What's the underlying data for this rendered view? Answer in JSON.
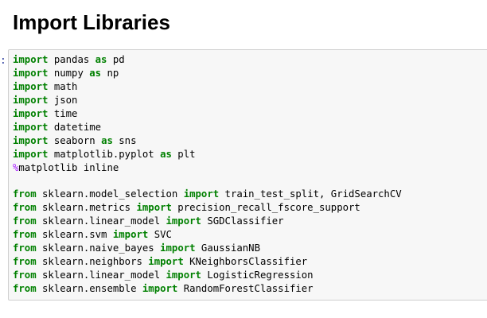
{
  "section": {
    "title": "Import Libraries"
  },
  "cell": {
    "prompt": ":",
    "lines": [
      [
        {
          "t": "import",
          "k": "kw"
        },
        {
          "t": " pandas ",
          "k": "plain"
        },
        {
          "t": "as",
          "k": "kw"
        },
        {
          "t": " pd",
          "k": "plain"
        }
      ],
      [
        {
          "t": "import",
          "k": "kw"
        },
        {
          "t": " numpy ",
          "k": "plain"
        },
        {
          "t": "as",
          "k": "kw"
        },
        {
          "t": " np",
          "k": "plain"
        }
      ],
      [
        {
          "t": "import",
          "k": "kw"
        },
        {
          "t": " math",
          "k": "plain"
        }
      ],
      [
        {
          "t": "import",
          "k": "kw"
        },
        {
          "t": " json",
          "k": "plain"
        }
      ],
      [
        {
          "t": "import",
          "k": "kw"
        },
        {
          "t": " time",
          "k": "plain"
        }
      ],
      [
        {
          "t": "import",
          "k": "kw"
        },
        {
          "t": " datetime",
          "k": "plain"
        }
      ],
      [
        {
          "t": "import",
          "k": "kw"
        },
        {
          "t": " seaborn ",
          "k": "plain"
        },
        {
          "t": "as",
          "k": "kw"
        },
        {
          "t": " sns",
          "k": "plain"
        }
      ],
      [
        {
          "t": "import",
          "k": "kw"
        },
        {
          "t": " matplotlib.pyplot ",
          "k": "plain"
        },
        {
          "t": "as",
          "k": "kw"
        },
        {
          "t": " plt",
          "k": "plain"
        }
      ],
      [
        {
          "t": "%",
          "k": "magic"
        },
        {
          "t": "matplotlib inline",
          "k": "plain"
        }
      ],
      [],
      [
        {
          "t": "from",
          "k": "kw"
        },
        {
          "t": " sklearn.model_selection ",
          "k": "plain"
        },
        {
          "t": "import",
          "k": "kw"
        },
        {
          "t": " train_test_split, GridSearchCV",
          "k": "plain"
        }
      ],
      [
        {
          "t": "from",
          "k": "kw"
        },
        {
          "t": " sklearn.metrics ",
          "k": "plain"
        },
        {
          "t": "import",
          "k": "kw"
        },
        {
          "t": " precision_recall_fscore_support",
          "k": "plain"
        }
      ],
      [
        {
          "t": "from",
          "k": "kw"
        },
        {
          "t": " sklearn.linear_model ",
          "k": "plain"
        },
        {
          "t": "import",
          "k": "kw"
        },
        {
          "t": " SGDClassifier",
          "k": "plain"
        }
      ],
      [
        {
          "t": "from",
          "k": "kw"
        },
        {
          "t": " sklearn.svm ",
          "k": "plain"
        },
        {
          "t": "import",
          "k": "kw"
        },
        {
          "t": " SVC",
          "k": "plain"
        }
      ],
      [
        {
          "t": "from",
          "k": "kw"
        },
        {
          "t": " sklearn.naive_bayes ",
          "k": "plain"
        },
        {
          "t": "import",
          "k": "kw"
        },
        {
          "t": " GaussianNB",
          "k": "plain"
        }
      ],
      [
        {
          "t": "from",
          "k": "kw"
        },
        {
          "t": " sklearn.neighbors ",
          "k": "plain"
        },
        {
          "t": "import",
          "k": "kw"
        },
        {
          "t": " KNeighborsClassifier",
          "k": "plain"
        }
      ],
      [
        {
          "t": "from",
          "k": "kw"
        },
        {
          "t": " sklearn.linear_model ",
          "k": "plain"
        },
        {
          "t": "import",
          "k": "kw"
        },
        {
          "t": " LogisticRegression",
          "k": "plain"
        }
      ],
      [
        {
          "t": "from",
          "k": "kw"
        },
        {
          "t": " sklearn.ensemble ",
          "k": "plain"
        },
        {
          "t": "import",
          "k": "kw"
        },
        {
          "t": " RandomForestClassifier",
          "k": "plain"
        }
      ]
    ]
  },
  "colors": {
    "keyword": "#008000",
    "magic": "#aa22ff",
    "cell_background": "#f7f7f7",
    "cell_border": "#cfcfcf"
  }
}
